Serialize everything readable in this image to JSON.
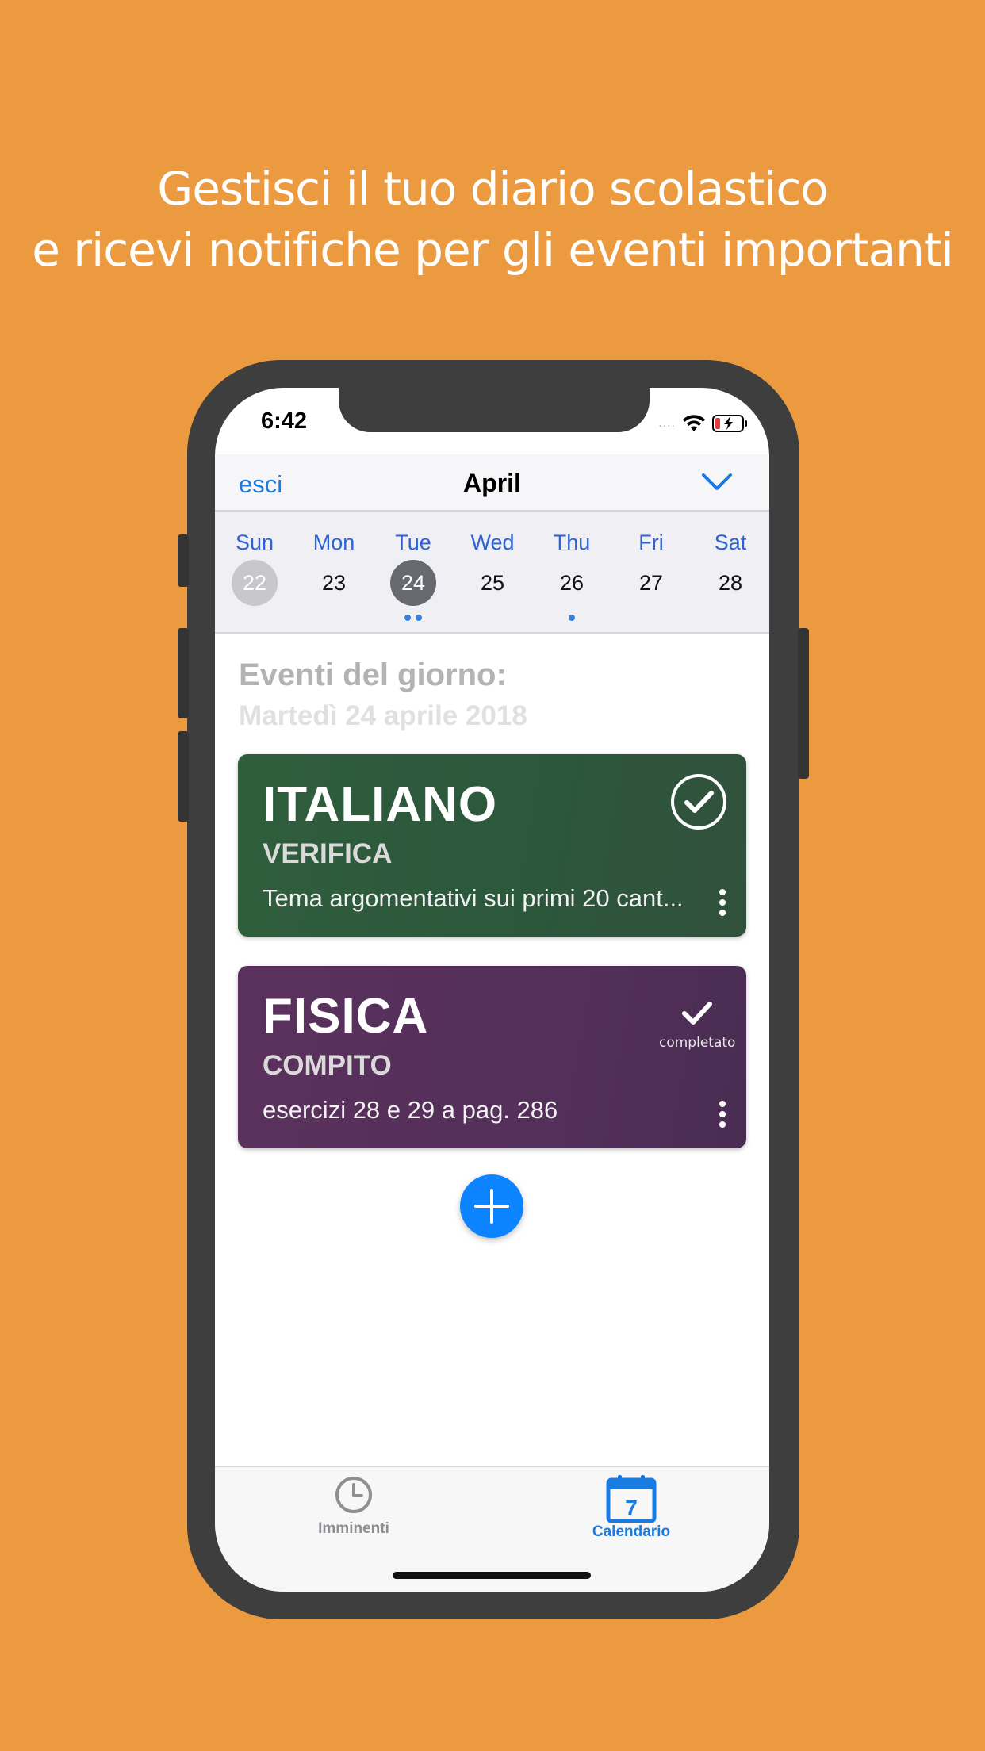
{
  "headline": {
    "line1": "Gestisci il tuo diario scolastico",
    "line2": "e ricevi notifiche per gli eventi importanti"
  },
  "status": {
    "time": "6:42",
    "signal": "....",
    "wifi_icon": "wifi-icon",
    "battery_icon": "battery-charging-icon"
  },
  "nav": {
    "left": "esci",
    "title": "April",
    "right_icon": "chevron-down-icon"
  },
  "week": {
    "days": [
      {
        "name": "Sun",
        "num": "22",
        "state": "past",
        "dots": 0
      },
      {
        "name": "Mon",
        "num": "23",
        "state": "",
        "dots": 0
      },
      {
        "name": "Tue",
        "num": "24",
        "state": "selected",
        "dots": 2
      },
      {
        "name": "Wed",
        "num": "25",
        "state": "",
        "dots": 0
      },
      {
        "name": "Thu",
        "num": "26",
        "state": "",
        "dots": 1
      },
      {
        "name": "Fri",
        "num": "27",
        "state": "",
        "dots": 0
      },
      {
        "name": "Sat",
        "num": "28",
        "state": "",
        "dots": 0
      }
    ]
  },
  "section": {
    "title": "Eventi del giorno:",
    "date": "Martedì 24 aprile 2018"
  },
  "events": [
    {
      "subject": "ITALIANO",
      "type": "VERIFICA",
      "description": "Tema argomentativi sui primi 20 cant...",
      "status_icon": "check-circle-icon",
      "color": "#2E5E3C"
    },
    {
      "subject": "FISICA",
      "type": "COMPITO",
      "description": "esercizi 28 e 29 a pag. 286",
      "status_icon": "check-icon",
      "status_label": "completato",
      "color": "#5A315C"
    }
  ],
  "fab": {
    "icon": "plus-icon",
    "color": "#0D84FF"
  },
  "tabs": [
    {
      "label": "Imminenti",
      "icon": "clock-icon",
      "active": false
    },
    {
      "label": "Calendario",
      "icon": "calendar-icon",
      "badge": "7",
      "active": true
    }
  ],
  "colors": {
    "background": "#EB9A40",
    "accent": "#1A7BE0"
  }
}
